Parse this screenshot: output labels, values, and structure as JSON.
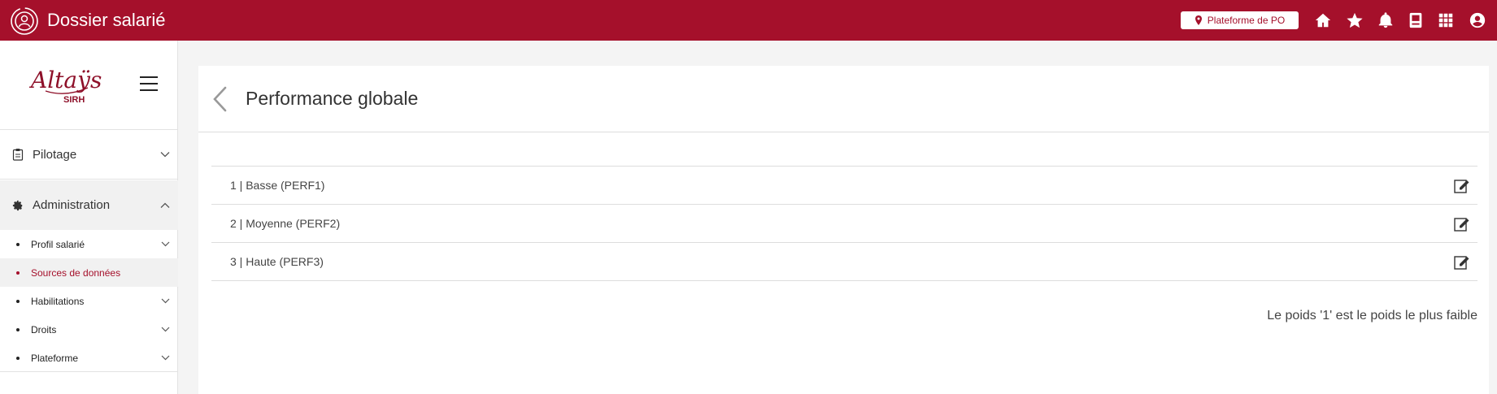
{
  "header": {
    "app_title": "Dossier salarié",
    "app_icon": "user-circle-icon",
    "platform_label": "Plateforme de PO",
    "platform_icon": "map-pin-icon",
    "icons": [
      "home-icon",
      "star-icon",
      "bell-icon",
      "book-icon",
      "apps-grid-icon",
      "account-icon"
    ],
    "brand_color": "#a5102b"
  },
  "sidebar": {
    "logo_text": "Altaÿs",
    "logo_subtext": "SIRH",
    "sections": [
      {
        "label": "Pilotage",
        "icon": "clipboard-icon",
        "expanded": false
      },
      {
        "label": "Administration",
        "icon": "gear-icon",
        "expanded": true
      }
    ],
    "subitems": [
      {
        "label": "Profil salarié",
        "has_chevron": true,
        "active": false
      },
      {
        "label": "Sources de données",
        "has_chevron": false,
        "active": true
      },
      {
        "label": "Habilitations",
        "has_chevron": true,
        "active": false
      },
      {
        "label": "Droits",
        "has_chevron": true,
        "active": false
      },
      {
        "label": "Plateforme",
        "has_chevron": true,
        "active": false
      }
    ]
  },
  "main": {
    "title": "Performance globale",
    "back_icon": "chevron-left-icon",
    "rows": [
      {
        "text": "1 | Basse (PERF1)",
        "icon": "edit-icon"
      },
      {
        "text": "2 | Moyenne (PERF2)",
        "icon": "edit-icon"
      },
      {
        "text": "3 | Haute (PERF3)",
        "icon": "edit-icon"
      }
    ],
    "note": "Le poids '1' est le poids le plus faible"
  }
}
